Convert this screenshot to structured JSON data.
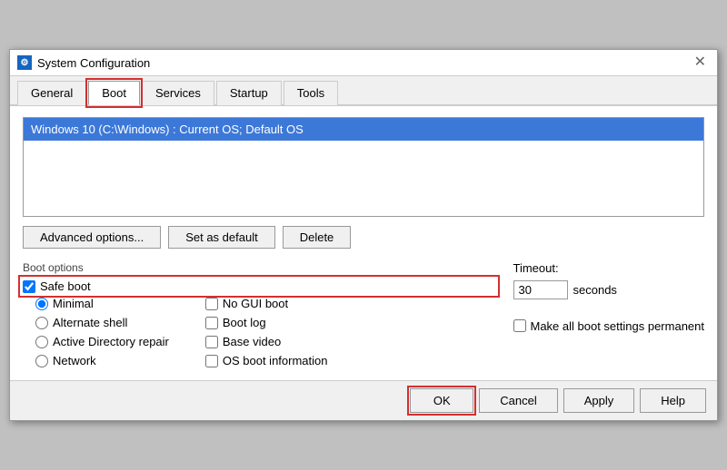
{
  "window": {
    "title": "System Configuration",
    "icon_label": "SC"
  },
  "tabs": [
    {
      "id": "general",
      "label": "General",
      "active": false,
      "highlighted": false
    },
    {
      "id": "boot",
      "label": "Boot",
      "active": true,
      "highlighted": true
    },
    {
      "id": "services",
      "label": "Services",
      "active": false,
      "highlighted": false
    },
    {
      "id": "startup",
      "label": "Startup",
      "active": false,
      "highlighted": false
    },
    {
      "id": "tools",
      "label": "Tools",
      "active": false,
      "highlighted": false
    }
  ],
  "os_item": {
    "label": "Windows 10 (C:\\Windows) : Current OS; Default OS"
  },
  "buttons": {
    "advanced_options": "Advanced options...",
    "set_as_default": "Set as default",
    "delete": "Delete"
  },
  "boot_options": {
    "section_label": "Boot options",
    "safe_boot_label": "Safe boot",
    "safe_boot_checked": true,
    "safe_boot_highlighted": true,
    "radios": [
      {
        "id": "minimal",
        "label": "Minimal",
        "checked": true
      },
      {
        "id": "alternate_shell",
        "label": "Alternate shell",
        "checked": false
      },
      {
        "id": "active_directory",
        "label": "Active Directory repair",
        "checked": false
      },
      {
        "id": "network",
        "label": "Network",
        "checked": false
      }
    ],
    "right_checkboxes": [
      {
        "id": "no_gui_boot",
        "label": "No GUI boot",
        "checked": false
      },
      {
        "id": "boot_log",
        "label": "Boot log",
        "checked": false
      },
      {
        "id": "base_video",
        "label": "Base video",
        "checked": false
      },
      {
        "id": "os_boot_info",
        "label": "OS boot information",
        "checked": false
      }
    ]
  },
  "timeout": {
    "label": "Timeout:",
    "value": "30",
    "unit": "seconds"
  },
  "make_permanent": {
    "label": "Make all boot settings permanent",
    "checked": false
  },
  "footer": {
    "ok_label": "OK",
    "cancel_label": "Cancel",
    "apply_label": "Apply",
    "help_label": "Help"
  }
}
